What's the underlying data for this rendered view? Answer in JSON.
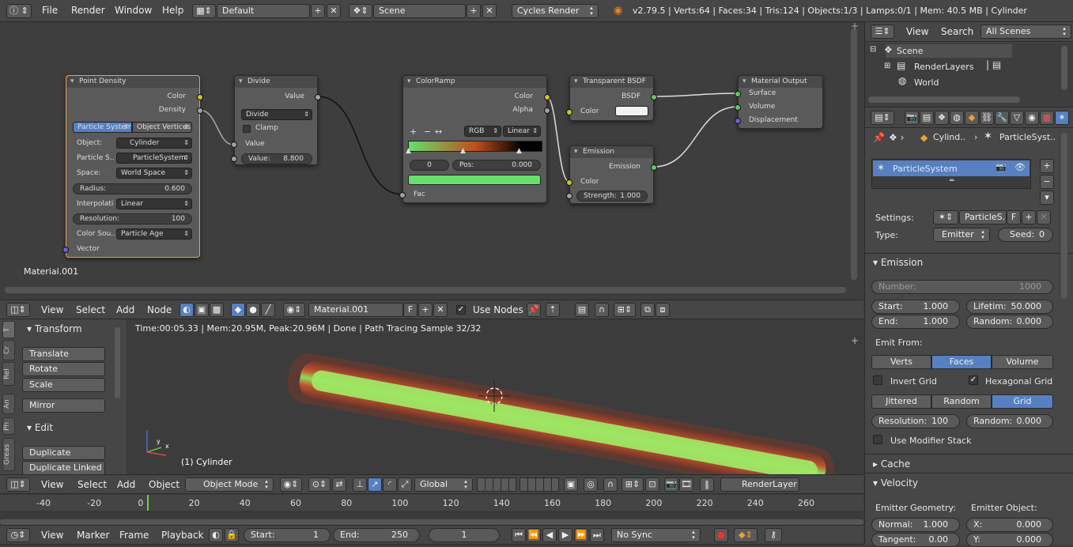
{
  "topbar": {
    "menus": [
      "File",
      "Render",
      "Window",
      "Help"
    ],
    "layout": "Default",
    "scene": "Scene",
    "engine": "Cycles Render",
    "status": "v2.79.5 | Verts:64 | Faces:34 | Tris:124 | Objects:1/3 | Lamps:0/1 | Mem: 40.5 MB | Cylinder"
  },
  "nodes": {
    "point_density": {
      "title": "Point Density",
      "out_color": "Color",
      "out_density": "Density",
      "tab_particle": "Particle System",
      "tab_vertices": "Object Vertices",
      "object_label": "Object:",
      "object_value": "Cylinder",
      "psys_label": "Particle S..",
      "psys_value": "ParticleSystem",
      "space_label": "Space:",
      "space_value": "World Space",
      "radius_label": "Radius:",
      "radius_value": "0.600",
      "interp_label": "Interpolati",
      "interp_value": "Linear",
      "res_label": "Resolution:",
      "res_value": "100",
      "colorsrc_label": "Color Sou..",
      "colorsrc_value": "Particle Age",
      "in_vector": "Vector"
    },
    "divide": {
      "title": "Divide",
      "out_value": "Value",
      "op": "Divide",
      "clamp": "Clamp",
      "in_value": "Value",
      "value_label": "Value:",
      "value": "8.800"
    },
    "colorramp": {
      "title": "ColorRamp",
      "out_color": "Color",
      "out_alpha": "Alpha",
      "add": "+",
      "remove": "−",
      "flip": "↔",
      "mode": "RGB",
      "interp": "Linear",
      "index": "0",
      "pos_label": "Pos:",
      "pos": "0.000",
      "in_fac": "Fac"
    },
    "transparent": {
      "title": "Transparent BSDF",
      "out": "BSDF",
      "in_color": "Color"
    },
    "emission": {
      "title": "Emission",
      "out": "Emission",
      "in_color": "Color",
      "strength_label": "Strength:",
      "strength": "1.000"
    },
    "output": {
      "title": "Material Output",
      "surface": "Surface",
      "volume": "Volume",
      "displacement": "Displacement"
    },
    "material_name": "Material.001"
  },
  "node_header": {
    "menus": [
      "View",
      "Select",
      "Add",
      "Node"
    ],
    "material": "Material.001",
    "fake_user": "F",
    "use_nodes": "Use Nodes"
  },
  "toolshelf": {
    "tabs": [
      "T",
      "Cr",
      "Rel",
      "An",
      "Ph",
      "Greas"
    ],
    "transform_title": "Transform",
    "translate": "Translate",
    "rotate": "Rotate",
    "scale": "Scale",
    "mirror": "Mirror",
    "edit_title": "Edit",
    "duplicate": "Duplicate",
    "duplicate_linked": "Duplicate Linked"
  },
  "viewport": {
    "render_status": "Time:00:05.33 | Mem:20.95M, Peak:20.96M | Done | Path Tracing Sample 32/32",
    "object_label": "(1) Cylinder",
    "axis_x": "x",
    "axis_y": "y"
  },
  "view3d_header": {
    "menus": [
      "View",
      "Select",
      "Add",
      "Object"
    ],
    "mode": "Object Mode",
    "orientation": "Global",
    "render_layer": "RenderLayer"
  },
  "timeline": {
    "ticks": [
      "-40",
      "-20",
      "0",
      "20",
      "40",
      "60",
      "80",
      "100",
      "120",
      "140",
      "160",
      "180",
      "200",
      "220",
      "240",
      "260"
    ],
    "menus": [
      "View",
      "Marker",
      "Frame",
      "Playback"
    ],
    "start_label": "Start:",
    "start": "1",
    "end_label": "End:",
    "end": "250",
    "current": "1",
    "sync": "No Sync"
  },
  "outliner": {
    "menus": [
      "View",
      "Search"
    ],
    "filter": "All Scenes",
    "items": [
      "Scene",
      "RenderLayers",
      "World"
    ]
  },
  "properties": {
    "breadcrumb_obj": "Cylind..",
    "breadcrumb_psys": "ParticleSyst..",
    "list_item": "ParticleSystem",
    "settings_label": "Settings:",
    "settings_value": "ParticleS..",
    "settings_f": "F",
    "type_label": "Type:",
    "type_value": "Emitter",
    "seed_label": "Seed:",
    "seed_value": "0",
    "emission_title": "Emission",
    "number_label": "Number:",
    "number_value": "1000",
    "start_label": "Start:",
    "start_value": "1.000",
    "end_label": "End:",
    "end_value": "1.000",
    "lifetime_label": "Lifetim:",
    "lifetime_value": "50.000",
    "random_label": "Random:",
    "random_value": "0.000",
    "emit_from_label": "Emit From:",
    "verts": "Verts",
    "faces": "Faces",
    "volume": "Volume",
    "invert_grid": "Invert Grid",
    "hex_grid": "Hexagonal Grid",
    "jittered": "Jittered",
    "random_dist": "Random",
    "grid": "Grid",
    "resolution_label": "Resolution:",
    "resolution_value": "100",
    "random2_label": "Random:",
    "random2_value": "0.000",
    "modifier_stack": "Use Modifier Stack",
    "cache_title": "Cache",
    "velocity_title": "Velocity",
    "emitter_geometry": "Emitter Geometry:",
    "emitter_object": "Emitter Object:",
    "normal_label": "Normal:",
    "normal_value": "1.000",
    "tangent_label": "Tangent:",
    "tangent_value": "0.00",
    "x_label": "X:",
    "x_value": "0.000",
    "y_label": "Y:",
    "y_value": "0.000"
  }
}
